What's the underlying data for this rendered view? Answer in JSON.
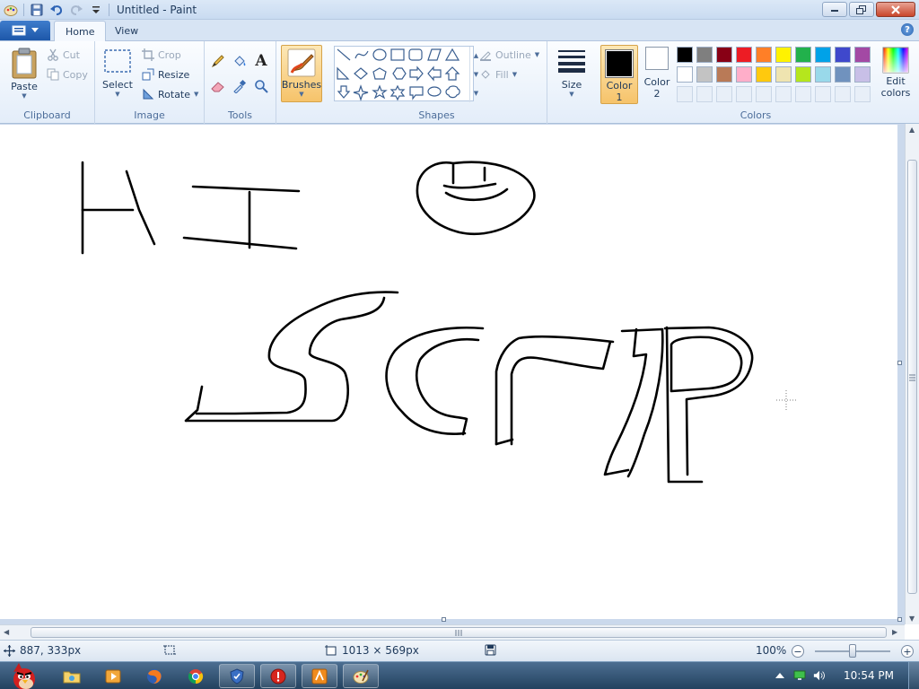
{
  "window": {
    "title": "Untitled - Paint"
  },
  "tabs": [
    {
      "label": "Home",
      "active": true
    },
    {
      "label": "View",
      "active": false
    }
  ],
  "ribbon": {
    "clipboard": {
      "label": "Clipboard",
      "paste": "Paste",
      "cut": "Cut",
      "copy": "Copy"
    },
    "image": {
      "label": "Image",
      "select": "Select",
      "crop": "Crop",
      "resize": "Resize",
      "rotate": "Rotate"
    },
    "tools": {
      "label": "Tools"
    },
    "brushes": {
      "label": "Brushes"
    },
    "shapes": {
      "label": "Shapes",
      "outline": "Outline",
      "fill": "Fill"
    },
    "size": {
      "label": "Size"
    },
    "color1": {
      "label1": "Color",
      "label2": "1",
      "value": "#000000"
    },
    "color2": {
      "label1": "Color",
      "label2": "2",
      "value": "#ffffff"
    },
    "colors": {
      "label": "Colors",
      "edit1": "Edit",
      "edit2": "colors",
      "row1": [
        "#000000",
        "#7f7f7f",
        "#880015",
        "#ed1c24",
        "#ff7f27",
        "#fff200",
        "#22b14c",
        "#00a2e8",
        "#3f48cc",
        "#a349a4"
      ],
      "row2": [
        "#ffffff",
        "#c3c3c3",
        "#b97a57",
        "#ffaec9",
        "#ffc90e",
        "#efe4b0",
        "#b5e61d",
        "#99d9ea",
        "#7092be",
        "#c8bfe7"
      ]
    }
  },
  "status": {
    "cursor_pos": "887, 333px",
    "canvas_size": "1013 × 569px",
    "zoom": "100%"
  },
  "taskbar": {
    "clock": "10:54 PM"
  },
  "colors": {
    "accent": "#f8c76b",
    "ribbon_bg": "#e3edf9",
    "title_bg": "#dbe8f7"
  }
}
